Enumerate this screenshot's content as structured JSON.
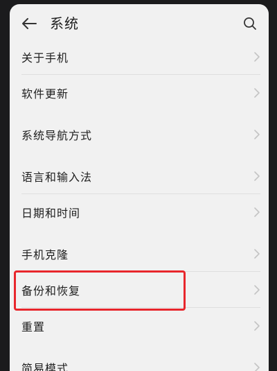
{
  "header": {
    "title": "系统",
    "back_icon": "arrow-left-icon",
    "search_icon": "search-icon"
  },
  "groups": [
    {
      "items": [
        {
          "label": "关于手机"
        },
        {
          "label": "软件更新"
        }
      ]
    },
    {
      "items": [
        {
          "label": "系统导航方式"
        }
      ]
    },
    {
      "items": [
        {
          "label": "语言和输入法"
        },
        {
          "label": "日期和时间"
        }
      ]
    },
    {
      "items": [
        {
          "label": "手机克隆"
        },
        {
          "label": "备份和恢复"
        },
        {
          "label": "重置"
        }
      ]
    },
    {
      "items": [
        {
          "label": "简易模式"
        }
      ]
    }
  ],
  "highlight": {
    "target": "备份和恢复",
    "color": "#e8262c"
  },
  "colors": {
    "background": "#f1f1f1",
    "text": "#1e1e1e",
    "chevron": "#c4c4c4",
    "divider": "#dedede"
  }
}
